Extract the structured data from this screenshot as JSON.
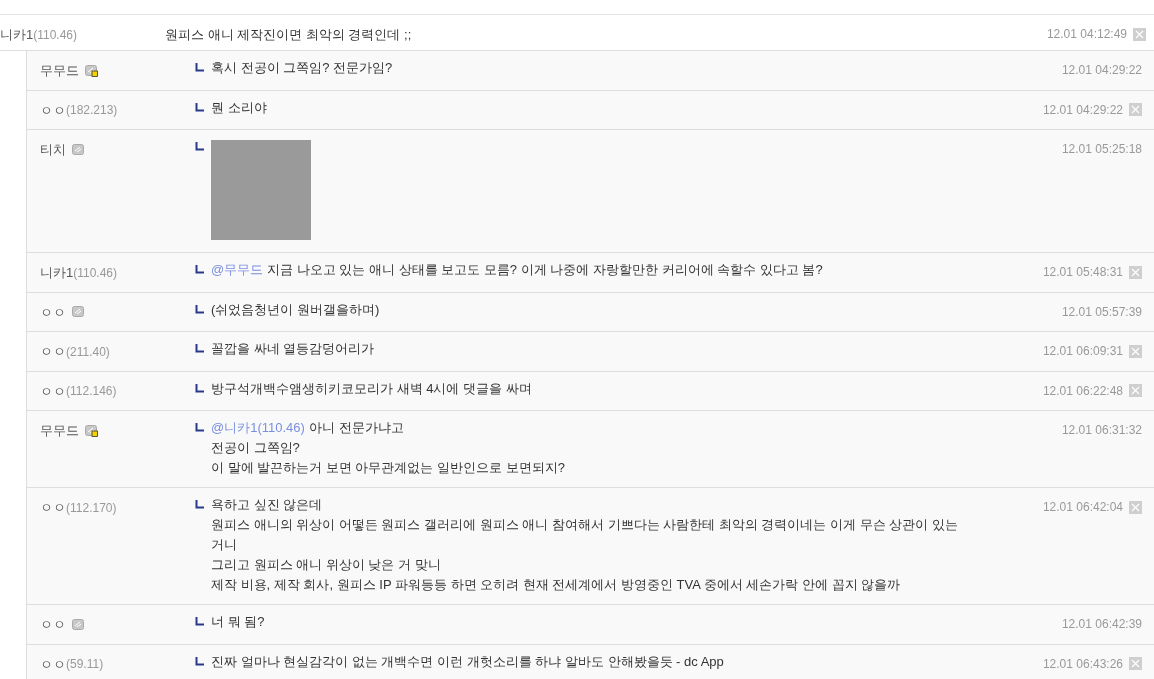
{
  "comment": {
    "nick": "니카1",
    "ip": "(110.46)",
    "member": false,
    "text": "원피스 애니 제작진이면 최악의 경력인데 ;;",
    "time": "12.01 04:12:49",
    "deletable": true
  },
  "replies": [
    {
      "kind": "text",
      "nick": "무무드",
      "member": true,
      "locked": true,
      "lines": [
        "혹시 전공이 그쪽임? 전문가임?"
      ],
      "time": "12.01 04:29:22",
      "deletable": false
    },
    {
      "kind": "text",
      "nick": "ㅇㅇ",
      "ip": "(182.213)",
      "member": false,
      "lines": [
        "뭔 소리야"
      ],
      "time": "12.01 04:29:22",
      "deletable": true
    },
    {
      "kind": "image",
      "nick": "티치",
      "member": true,
      "locked": false,
      "time": "12.01 05:25:18",
      "deletable": false
    },
    {
      "kind": "text",
      "nick": "니카1",
      "ip": "(110.46)",
      "member": false,
      "mention": "@무무드",
      "lines": [
        "지금 나오고 있는 애니 상태를 보고도 모름? 이게 나중에 자랑할만한 커리어에 속할수 있다고 봄?"
      ],
      "time": "12.01 05:48:31",
      "deletable": true
    },
    {
      "kind": "text",
      "nick": "ㅇㅇ",
      "member": true,
      "locked": false,
      "lines": [
        "(쉬었음청년이 원버갤을하며)"
      ],
      "time": "12.01 05:57:39",
      "deletable": false
    },
    {
      "kind": "text",
      "nick": "ㅇㅇ",
      "ip": "(211.40)",
      "member": false,
      "lines": [
        "꼴깝을 싸네 열등감덩어리가"
      ],
      "time": "12.01 06:09:31",
      "deletable": true
    },
    {
      "kind": "text",
      "nick": "ㅇㅇ",
      "ip": "(112.146)",
      "member": false,
      "lines": [
        "방구석개백수앰생히키코모리가 새벽 4시에 댓글을 싸며"
      ],
      "time": "12.01 06:22:48",
      "deletable": true
    },
    {
      "kind": "text",
      "nick": "무무드",
      "member": true,
      "locked": true,
      "mention": "@니카1(110.46)",
      "lines": [
        "아니 전문가냐고",
        "전공이 그쪽임?",
        "이 말에 발끈하는거 보면 아무관계없는 일반인으로 보면되지?"
      ],
      "time": "12.01 06:31:32",
      "deletable": false
    },
    {
      "kind": "text",
      "nick": "ㅇㅇ",
      "ip": "(112.170)",
      "member": false,
      "lines": [
        "욕하고 싶진 않은데",
        "원피스 애니의 위상이 어떻든 원피스 갤러리에 원피스 애니 참여해서 기쁘다는 사람한테 최악의 경력이네는 이게 무슨 상관이 있는",
        "거니",
        "그리고 원피스 애니 위상이 낮은 거 맞니",
        "제작 비용, 제작 회사, 원피스 IP 파워등등 하면 오히려 현재 전세계에서 방영중인 TVA 중에서 세손가락 안에 꼽지 않을까"
      ],
      "time": "12.01 06:42:04",
      "deletable": true
    },
    {
      "kind": "text",
      "nick": "ㅇㅇ",
      "member": true,
      "locked": false,
      "lines": [
        "너 뭐 됨?"
      ],
      "time": "12.01 06:42:39",
      "deletable": false
    },
    {
      "kind": "text",
      "nick": "ㅇㅇ",
      "ip": "(59.11)",
      "member": false,
      "lines": [
        "진짜 얼마나 현실감각이 없는 개백수면 이런 개헛소리를 하냐 알바도 안해봤을듯 - dc App"
      ],
      "time": "12.01 06:43:26",
      "deletable": true
    }
  ]
}
